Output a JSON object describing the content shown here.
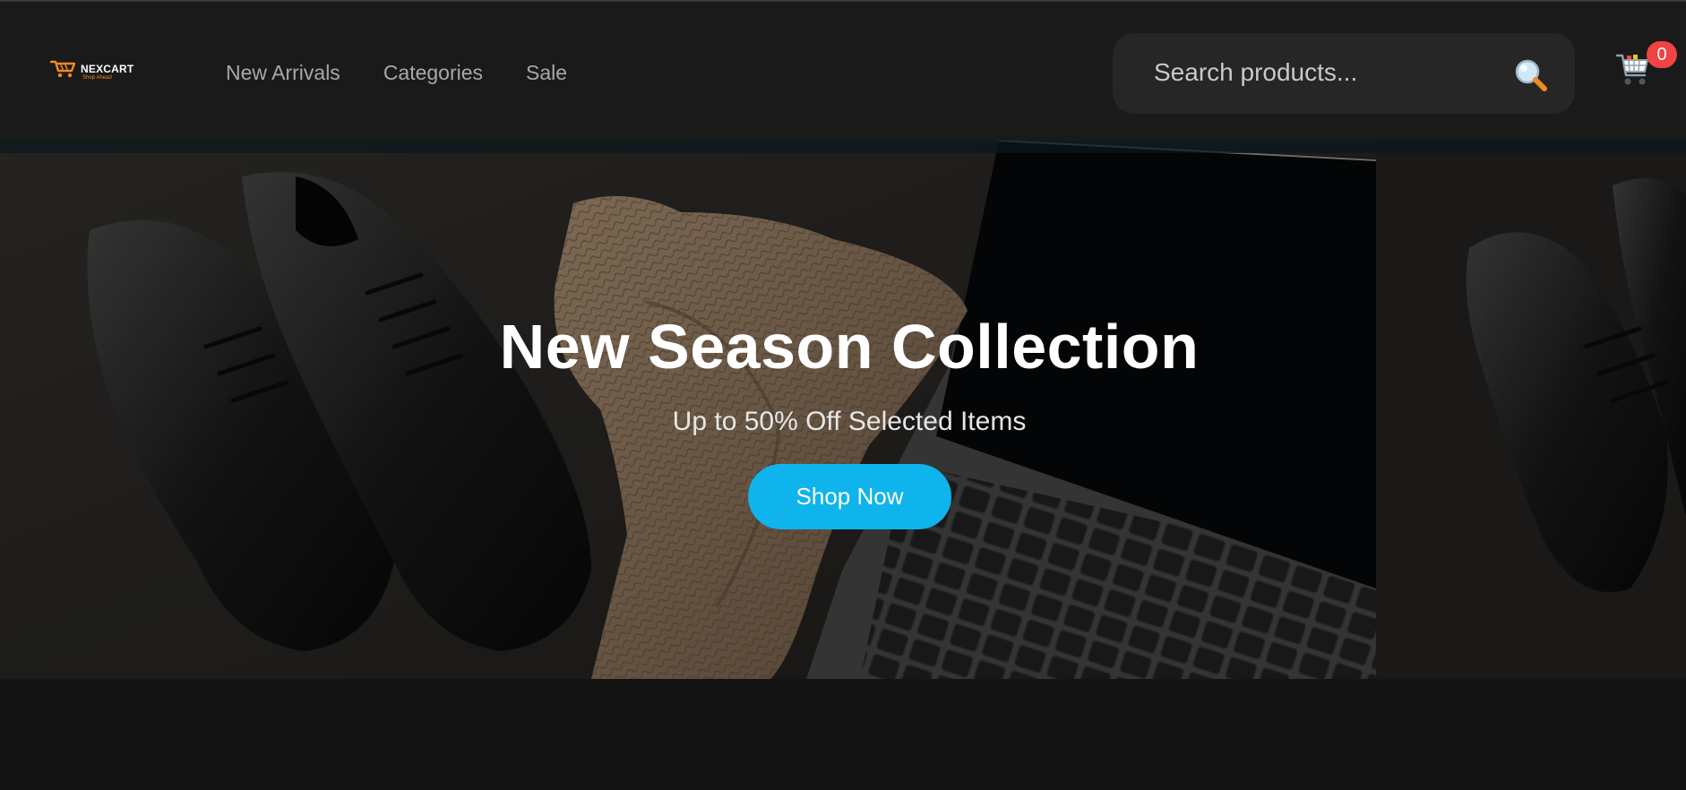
{
  "brand": {
    "name": "NEXCART",
    "tagline": "Shop Ahead",
    "accent_color": "#f08a1c"
  },
  "nav": {
    "items": [
      {
        "label": "New Arrivals"
      },
      {
        "label": "Categories"
      },
      {
        "label": "Sale"
      }
    ]
  },
  "search": {
    "placeholder": "Search products...",
    "value": "",
    "icon": "magnifying-glass-icon"
  },
  "cart": {
    "icon": "shopping-cart-icon",
    "count": "0",
    "badge_color": "#f04343"
  },
  "hero": {
    "title": "New Season Collection",
    "subtitle": "Up to 50% Off Selected Items",
    "button_label": "Shop Now",
    "button_color": "#0fb4ec"
  },
  "colors": {
    "background": "#131313",
    "header": "#1a1a1a",
    "search_background": "#262626"
  }
}
